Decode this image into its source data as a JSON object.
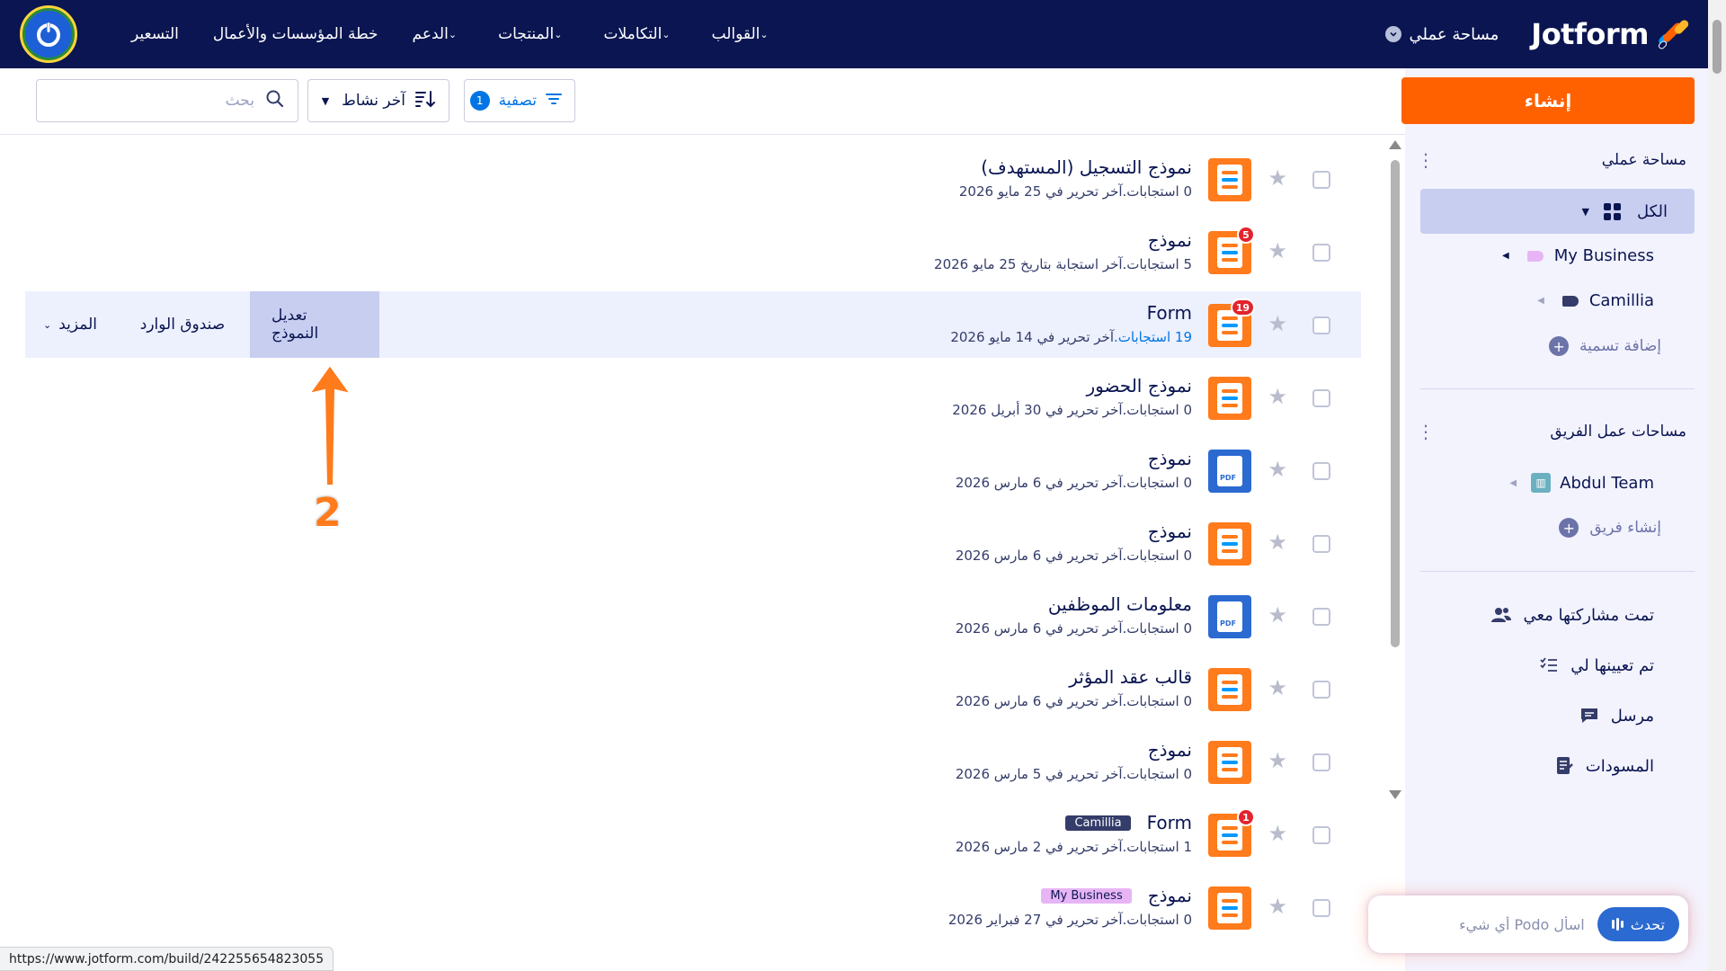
{
  "navbar": {
    "brand": "Jotform",
    "workspace_label": "مساحة عملي",
    "links": [
      {
        "label": "القوالب",
        "has_caret": true
      },
      {
        "label": "التكاملات",
        "has_caret": true
      },
      {
        "label": "المنتجات",
        "has_caret": true
      },
      {
        "label": "الدعم",
        "has_caret": true
      },
      {
        "label": "خطة المؤسسات والأعمال",
        "has_caret": false
      },
      {
        "label": "التسعير",
        "has_caret": false
      }
    ]
  },
  "sidebar": {
    "create_label": "إنشاء",
    "my_workspace_title": "مساحة عملي",
    "all_label": "الكل",
    "labels": [
      {
        "name": "My Business",
        "color": "#e7b5f5"
      },
      {
        "name": "Camillia",
        "color": "#343c6a"
      }
    ],
    "add_label": "إضافة تسمية",
    "team_workspaces_title": "مساحات عمل الفريق",
    "teams": [
      {
        "name": "Abdul Team"
      }
    ],
    "create_team": "إنشاء فريق",
    "links": [
      {
        "label": "تمت مشاركتها معي",
        "icon": "users-icon"
      },
      {
        "label": "تم تعيينها لي",
        "icon": "assigned-list-icon"
      },
      {
        "label": "مرسل",
        "icon": "sent-message-icon"
      },
      {
        "label": "المسودات",
        "icon": "drafts-icon"
      }
    ]
  },
  "toolbar": {
    "filter_label": "تصفية",
    "filter_count": "1",
    "sort_label": "آخر نشاط",
    "search_placeholder": "بحث"
  },
  "forms": [
    {
      "title": "نموذج التسجيل (المستهدف)",
      "count": "0 استجابات.",
      "meta": "آخر تحرير في 25 مايو 2026",
      "icon": "form",
      "badge": "",
      "tag": ""
    },
    {
      "title": "نموذج",
      "count": "5 استجابات.",
      "meta": "آخر استجابة بتاريخ 25 مايو 2026",
      "icon": "form",
      "badge": "5",
      "tag": ""
    },
    {
      "title": "Form",
      "count": "19 استجابات.",
      "meta": "آخر تحرير في 14 مايو 2026",
      "icon": "form",
      "badge": "19",
      "tag": "",
      "active": true
    },
    {
      "title": "نموذج الحضور",
      "count": "0 استجابات.",
      "meta": "آخر تحرير في 30 أبريل 2026",
      "icon": "form",
      "badge": "",
      "tag": ""
    },
    {
      "title": "نموذج",
      "count": "0 استجابات.",
      "meta": "آخر تحرير في 6 مارس 2026",
      "icon": "pdf",
      "badge": "",
      "tag": ""
    },
    {
      "title": "نموذج",
      "count": "0 استجابات.",
      "meta": "آخر تحرير في 6 مارس 2026",
      "icon": "form",
      "badge": "",
      "tag": ""
    },
    {
      "title": "معلومات الموظفين",
      "count": "0 استجابات.",
      "meta": "آخر تحرير في 6 مارس 2026",
      "icon": "pdf",
      "badge": "",
      "tag": ""
    },
    {
      "title": "قالب عقد المؤثر",
      "count": "0 استجابات.",
      "meta": "آخر تحرير في 6 مارس 2026",
      "icon": "form",
      "badge": "",
      "tag": ""
    },
    {
      "title": "نموذج",
      "count": "0 استجابات.",
      "meta": "آخر تحرير في 5 مارس 2026",
      "icon": "form",
      "badge": "",
      "tag": ""
    },
    {
      "title": "Form",
      "count": "1 استجابات.",
      "meta": "آخر تحرير في 2 مارس 2026",
      "icon": "form",
      "badge": "1",
      "tag": "Camillia"
    },
    {
      "title": "نموذج",
      "count": "0 استجابات.",
      "meta": "آخر تحرير في 27 فبراير 2026",
      "icon": "form",
      "badge": "",
      "tag": "My Business"
    }
  ],
  "row_actions": {
    "edit": "تعديل النموذج",
    "inbox": "صندوق الوارد",
    "more": "المزيد"
  },
  "annotation": {
    "number": "2"
  },
  "podo": {
    "button": "تحدث",
    "placeholder": "اسأل Podo أي شيء"
  },
  "status_url": "https://www.jotform.com/build/242255654823055",
  "colors": {
    "navy": "#0a1551",
    "orange": "#ff6100",
    "blue": "#0075e3",
    "sidebar_bg": "#f3f3fe",
    "highlight": "#c8cef0"
  }
}
